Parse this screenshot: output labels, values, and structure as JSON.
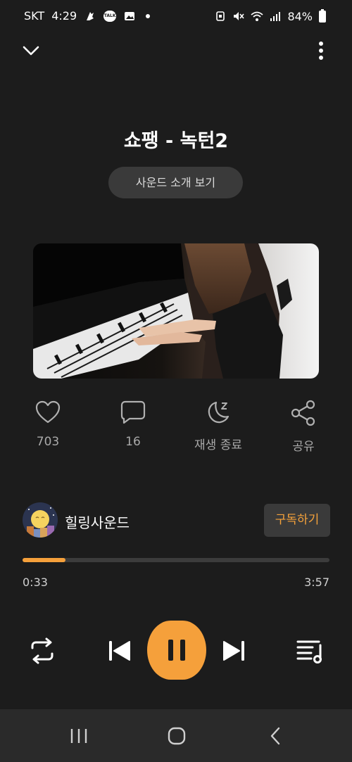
{
  "status_bar": {
    "carrier": "SKT",
    "time": "4:29",
    "talk_badge": "TALK",
    "battery": "84%"
  },
  "track": {
    "title": "쇼팽 - 녹턴2",
    "sound_intro_label": "사운드 소개 보기"
  },
  "actions": {
    "like_count": "703",
    "comment_count": "16",
    "sleep_label": "재생 종료",
    "share_label": "공유"
  },
  "channel": {
    "name": "힐링사운드",
    "subscribe_label": "구독하기"
  },
  "playback": {
    "current_time": "0:33",
    "total_time": "3:57",
    "progress_percent": 14,
    "state": "playing"
  },
  "colors": {
    "accent": "#f5a03b",
    "background": "#1c1c1c",
    "button_bg": "#3a3a3a"
  },
  "icons": {
    "top_left": "chevron-down-icon",
    "top_right": "more-vertical-icon",
    "like": "heart-icon",
    "comment": "comment-icon",
    "sleep": "moon-sleep-icon",
    "share": "share-icon",
    "repeat": "repeat-icon",
    "previous": "skip-previous-icon",
    "pause": "pause-icon",
    "next": "skip-next-icon",
    "playlist": "playlist-icon"
  }
}
